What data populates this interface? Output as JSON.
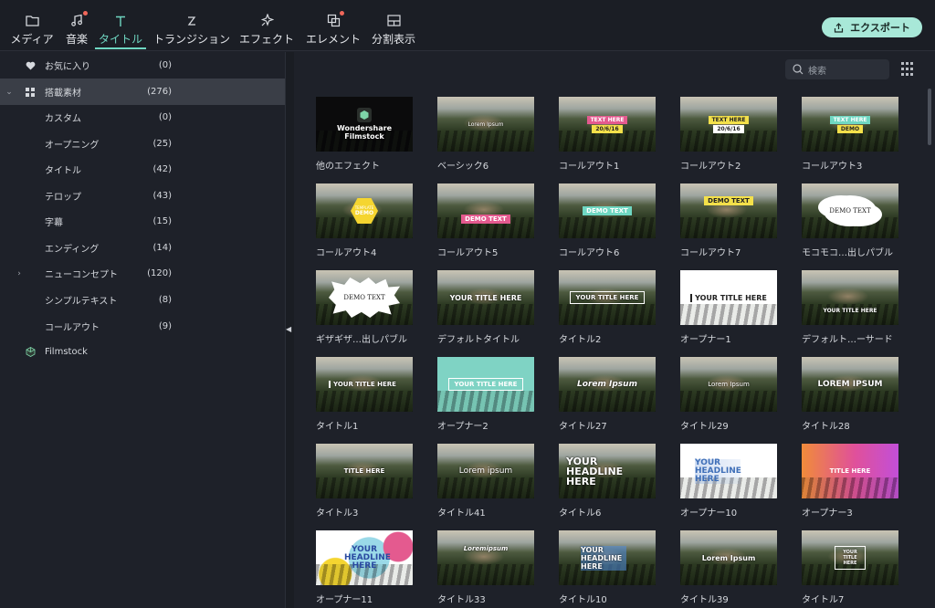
{
  "toolbar": {
    "tabs": [
      {
        "label": "メディア",
        "icon": "folder-icon"
      },
      {
        "label": "音楽",
        "icon": "music-note-icon"
      },
      {
        "label": "タイトル",
        "icon": "text-t-icon"
      },
      {
        "label": "トランジション",
        "icon": "transition-icon"
      },
      {
        "label": "エフェクト",
        "icon": "sparkle-icon"
      },
      {
        "label": "エレメント",
        "icon": "elements-icon"
      },
      {
        "label": "分割表示",
        "icon": "split-screen-icon"
      }
    ],
    "active_tab": "タイトル",
    "export_label": "エクスポート"
  },
  "sidebar": {
    "items": [
      {
        "label": "お気に入り",
        "count": "(0)"
      },
      {
        "label": "搭載素材",
        "count": "(276)"
      },
      {
        "label": "カスタム",
        "count": "(0)"
      },
      {
        "label": "オープニング",
        "count": "(25)"
      },
      {
        "label": "タイトル",
        "count": "(42)"
      },
      {
        "label": "テロップ",
        "count": "(43)"
      },
      {
        "label": "字幕",
        "count": "(15)"
      },
      {
        "label": "エンディング",
        "count": "(14)"
      },
      {
        "label": "ニューコンセプト",
        "count": "(120)"
      },
      {
        "label": "シンプルテキスト",
        "count": "(8)"
      },
      {
        "label": "コールアウト",
        "count": "(9)"
      },
      {
        "label": "Filmstock",
        "count": ""
      }
    ]
  },
  "search": {
    "placeholder": "検索"
  },
  "cards": [
    {
      "caption": "他のエフェクト",
      "overlay": "Wondershare Filmstock"
    },
    {
      "caption": "ベーシック6",
      "overlay": "Lorem Ipsum"
    },
    {
      "caption": "コールアウト1",
      "overlay": "TEXT HERE",
      "overlay2": "20/6/16"
    },
    {
      "caption": "コールアウト2",
      "overlay": "TEXT HERE",
      "overlay2": "20/6/16"
    },
    {
      "caption": "コールアウト3",
      "overlay": "TEXT HERE",
      "overlay2": "DEMO"
    },
    {
      "caption": "コールアウト4",
      "overlay": "TEMPLATE",
      "overlay2": "DEMO"
    },
    {
      "caption": "コールアウト5",
      "overlay": "DEMO TEXT"
    },
    {
      "caption": "コールアウト6",
      "overlay": "DEMO TEXT"
    },
    {
      "caption": "コールアウト7",
      "overlay": "DEMO TEXT"
    },
    {
      "caption": "モコモコ…出しパブル",
      "overlay": "DEMO TEXT"
    },
    {
      "caption": "ギザギザ…出しパブル",
      "overlay": "DEMO TEXT"
    },
    {
      "caption": "デフォルトタイトル",
      "overlay": "YOUR TITLE HERE"
    },
    {
      "caption": "タイトル2",
      "overlay": "YOUR TITLE HERE"
    },
    {
      "caption": "オープナー1",
      "overlay": "YOUR TITLE HERE"
    },
    {
      "caption": "デフォルト…ーサード",
      "overlay": "YOUR TITLE HERE"
    },
    {
      "caption": "タイトル1",
      "overlay": "YOUR TITLE HERE"
    },
    {
      "caption": "オープナー2",
      "overlay": "YOUR TITLE HERE"
    },
    {
      "caption": "タイトル27",
      "overlay": "Lorem Ipsum"
    },
    {
      "caption": "タイトル29",
      "overlay": "Lorem Ipsum"
    },
    {
      "caption": "タイトル28",
      "overlay": "LOREM IPSUM"
    },
    {
      "caption": "タイトル3",
      "overlay": "TITLE HERE"
    },
    {
      "caption": "タイトル41",
      "overlay": "Lorem ipsum"
    },
    {
      "caption": "タイトル6",
      "overlay": "YOUR HEADLINE HERE"
    },
    {
      "caption": "オープナー10",
      "overlay": "YOUR HEADLINE HERE"
    },
    {
      "caption": "オープナー3",
      "overlay": "TITLE HERE"
    },
    {
      "caption": "オープナー11",
      "overlay": "YOUR HEADLINE HERE"
    },
    {
      "caption": "タイトル33",
      "overlay": "Loremipsum"
    },
    {
      "caption": "タイトル10",
      "overlay": "YOUR HEADLINE HERE"
    },
    {
      "caption": "タイトル39",
      "overlay": "Lorem Ipsum"
    },
    {
      "caption": "タイトル7",
      "overlay": "YOUR TITLE HERE"
    }
  ],
  "colors": {
    "accent": "#6fd7c2",
    "export_bg": "#a8e8d8",
    "notify_dot": "#f0675a"
  }
}
